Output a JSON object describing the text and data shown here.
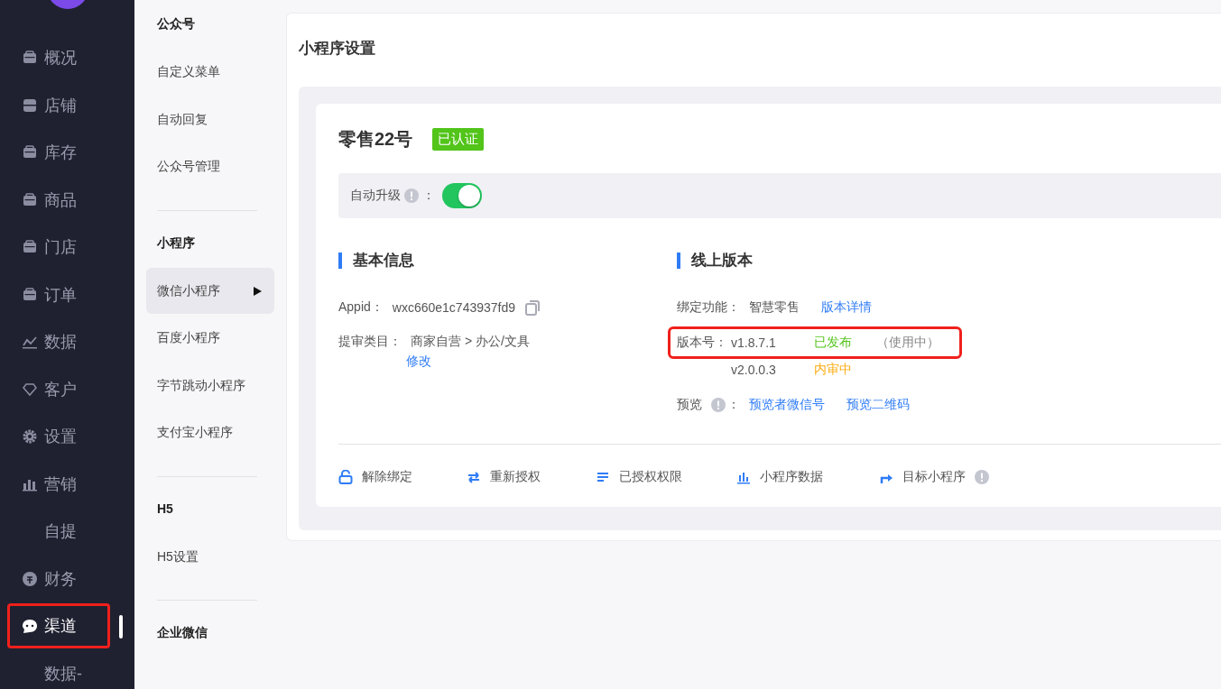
{
  "sidebar": {
    "items": [
      {
        "label": "概况",
        "selected": false,
        "highlighted": false
      },
      {
        "label": "店铺",
        "selected": false,
        "highlighted": false
      },
      {
        "label": "库存",
        "selected": false,
        "highlighted": false
      },
      {
        "label": "商品",
        "selected": false,
        "highlighted": false
      },
      {
        "label": "门店",
        "selected": false,
        "highlighted": false
      },
      {
        "label": "订单",
        "selected": false,
        "highlighted": false
      },
      {
        "label": "数据",
        "selected": false,
        "highlighted": false
      },
      {
        "label": "客户",
        "selected": false,
        "highlighted": false
      },
      {
        "label": "设置",
        "selected": false,
        "highlighted": false
      },
      {
        "label": "营销",
        "selected": false,
        "highlighted": false
      },
      {
        "label": "自提",
        "selected": false,
        "highlighted": false
      },
      {
        "label": "财务",
        "selected": false,
        "highlighted": false
      },
      {
        "label": "渠道",
        "selected": true,
        "highlighted": true
      },
      {
        "label": "数据-",
        "selected": false,
        "highlighted": false
      }
    ]
  },
  "submenu": {
    "groups": [
      {
        "title": "公众号",
        "items": [
          {
            "label": "自定义菜单",
            "selected": false
          },
          {
            "label": "自动回复",
            "selected": false
          },
          {
            "label": "公众号管理",
            "selected": false
          }
        ]
      },
      {
        "title": "小程序",
        "items": [
          {
            "label": "微信小程序",
            "selected": true
          },
          {
            "label": "百度小程序",
            "selected": false
          },
          {
            "label": "字节跳动小程序",
            "selected": false
          },
          {
            "label": "支付宝小程序",
            "selected": false
          }
        ]
      },
      {
        "title": "H5",
        "items": [
          {
            "label": "H5设置",
            "selected": false
          }
        ]
      },
      {
        "title": "企业微信"
      }
    ]
  },
  "page": {
    "title": "小程序设置"
  },
  "app": {
    "name": "零售22号",
    "badge": "已认证",
    "auto_upgrade": {
      "label": "自动升级",
      "colon": "：",
      "on": true
    }
  },
  "basic_info": {
    "title": "基本信息",
    "appid_label": "Appid：",
    "appid": "wxc660e1c743937fd9",
    "category_label": "提审类目：",
    "category": "商家自营 > 办公/文具",
    "edit_link": "修改"
  },
  "online_version": {
    "title": "线上版本",
    "feature_label": "绑定功能：",
    "feature": "智慧零售",
    "details_link": "版本详情",
    "version_label": "版本号：",
    "versions": [
      {
        "version": "v1.8.7.1",
        "status": "已发布",
        "kind": "published",
        "note": "（使用中）",
        "highlighted": true
      },
      {
        "version": "v2.0.0.3",
        "status": "内审中",
        "kind": "reviewing",
        "highlighted": false
      }
    ],
    "preview_label": "预览",
    "preview_colon": "：",
    "preview_links": [
      "预览者微信号",
      "预览二维码"
    ]
  },
  "actions": [
    {
      "label": "解除绑定",
      "info": false
    },
    {
      "label": "重新授权",
      "info": false
    },
    {
      "label": "已授权权限",
      "info": false
    },
    {
      "label": "小程序数据",
      "info": false
    },
    {
      "label": "目标小程序",
      "info": true
    }
  ]
}
